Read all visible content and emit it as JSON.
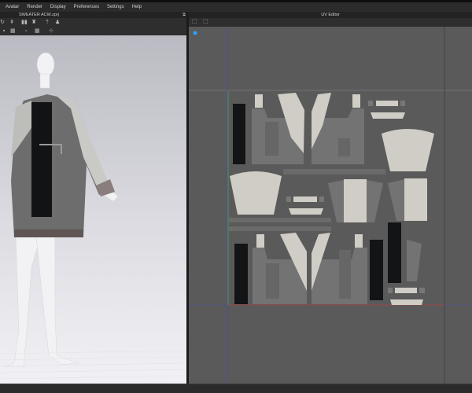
{
  "menu": [
    "Avatar",
    "Render",
    "Display",
    "Preferences",
    "Settings",
    "Help"
  ],
  "left_panel": {
    "title": "SWEATER ACW.zprj"
  },
  "uv_editor": {
    "title": "UV Editor"
  },
  "colors": {
    "uv_bg": "#5a5a5a",
    "piece_light": "#cfcdc6",
    "piece_gray": "#737373",
    "piece_black": "#121416",
    "axis_green": "#4f9a4f",
    "axis_red": "#9a4a4a",
    "axis_blue": "#4a4aa8"
  }
}
